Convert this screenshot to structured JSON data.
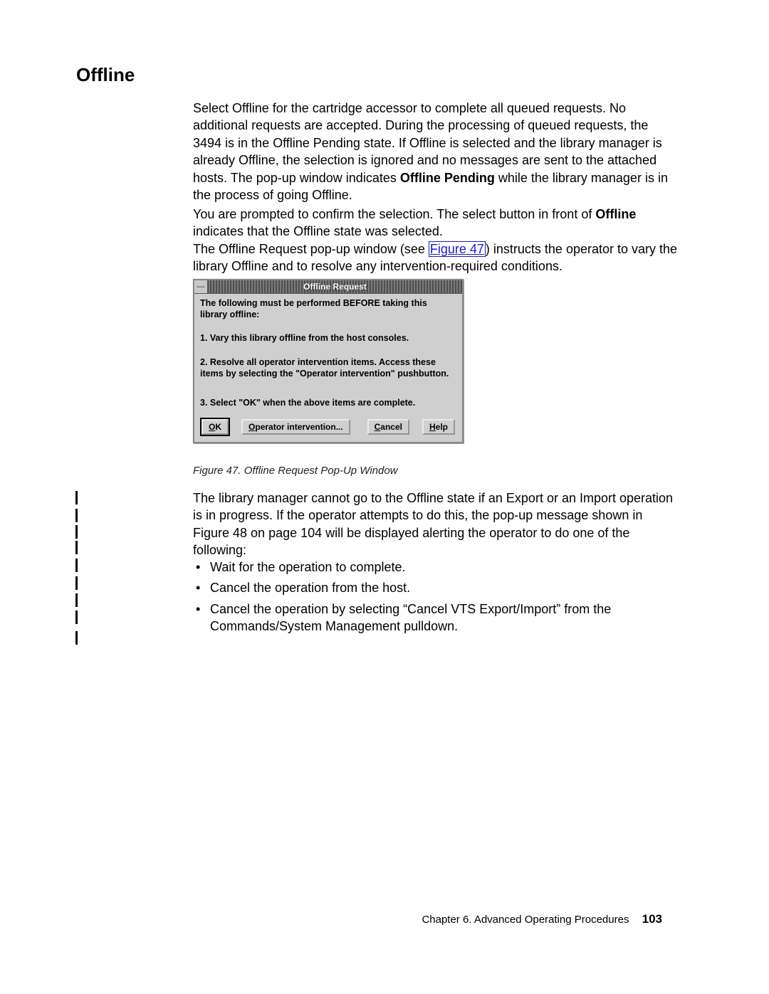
{
  "heading": "Offline",
  "para1": {
    "pre": "Select Offline for the cartridge accessor to complete all queued requests. No additional requests are accepted. During the processing of queued requests, the 3494 is in the Offline Pending state. If Offline is selected and the library manager is already Offline, the selection is ignored and no messages are sent to the attached hosts. The pop-up window indicates ",
    "bold": "Offline Pending",
    "post": " while the library manager is in the process of going Offline."
  },
  "para2": {
    "pre": "You are prompted to confirm the selection. The select button in front of ",
    "bold": "Offline",
    "post": " indicates that the Offline state was selected."
  },
  "para3": {
    "pre": "The Offline Request pop-up window (see ",
    "link": "Figure 47",
    "post": ") instructs the operator to vary the library Offline and to resolve any intervention-required conditions."
  },
  "dialog": {
    "title": "Offline Request",
    "sysmenu_glyph": "—",
    "intro": "The following must be performed BEFORE taking this library offline:",
    "step1": "1.  Vary this library offline from the host consoles.",
    "step2": "2.  Resolve all operator intervention items. Access these items by selecting the \"Operator intervention\" pushbutton.",
    "step3": "3. Select \"OK\" when the above items are complete.",
    "buttons": {
      "ok": "OK",
      "operator": "Operator intervention...",
      "cancel": "Cancel",
      "help": "Help"
    }
  },
  "caption": "Figure 47. Offline Request Pop-Up Window",
  "para4": "The library manager cannot go to the Offline state if an Export or an Import operation is in progress. If the operator attempts to do this, the pop-up message shown in Figure 48 on page 104 will be displayed alerting the operator to do one of the following:",
  "bullets": [
    "Wait for the operation to complete.",
    "Cancel the operation from the host.",
    "Cancel the operation by selecting “Cancel VTS Export/Import” from the Commands/System Management pulldown."
  ],
  "footer": {
    "chapter": "Chapter 6. Advanced Operating Procedures",
    "page": "103"
  },
  "revbar_tops": [
    690,
    715,
    738,
    760,
    785,
    810,
    834,
    858,
    887
  ]
}
